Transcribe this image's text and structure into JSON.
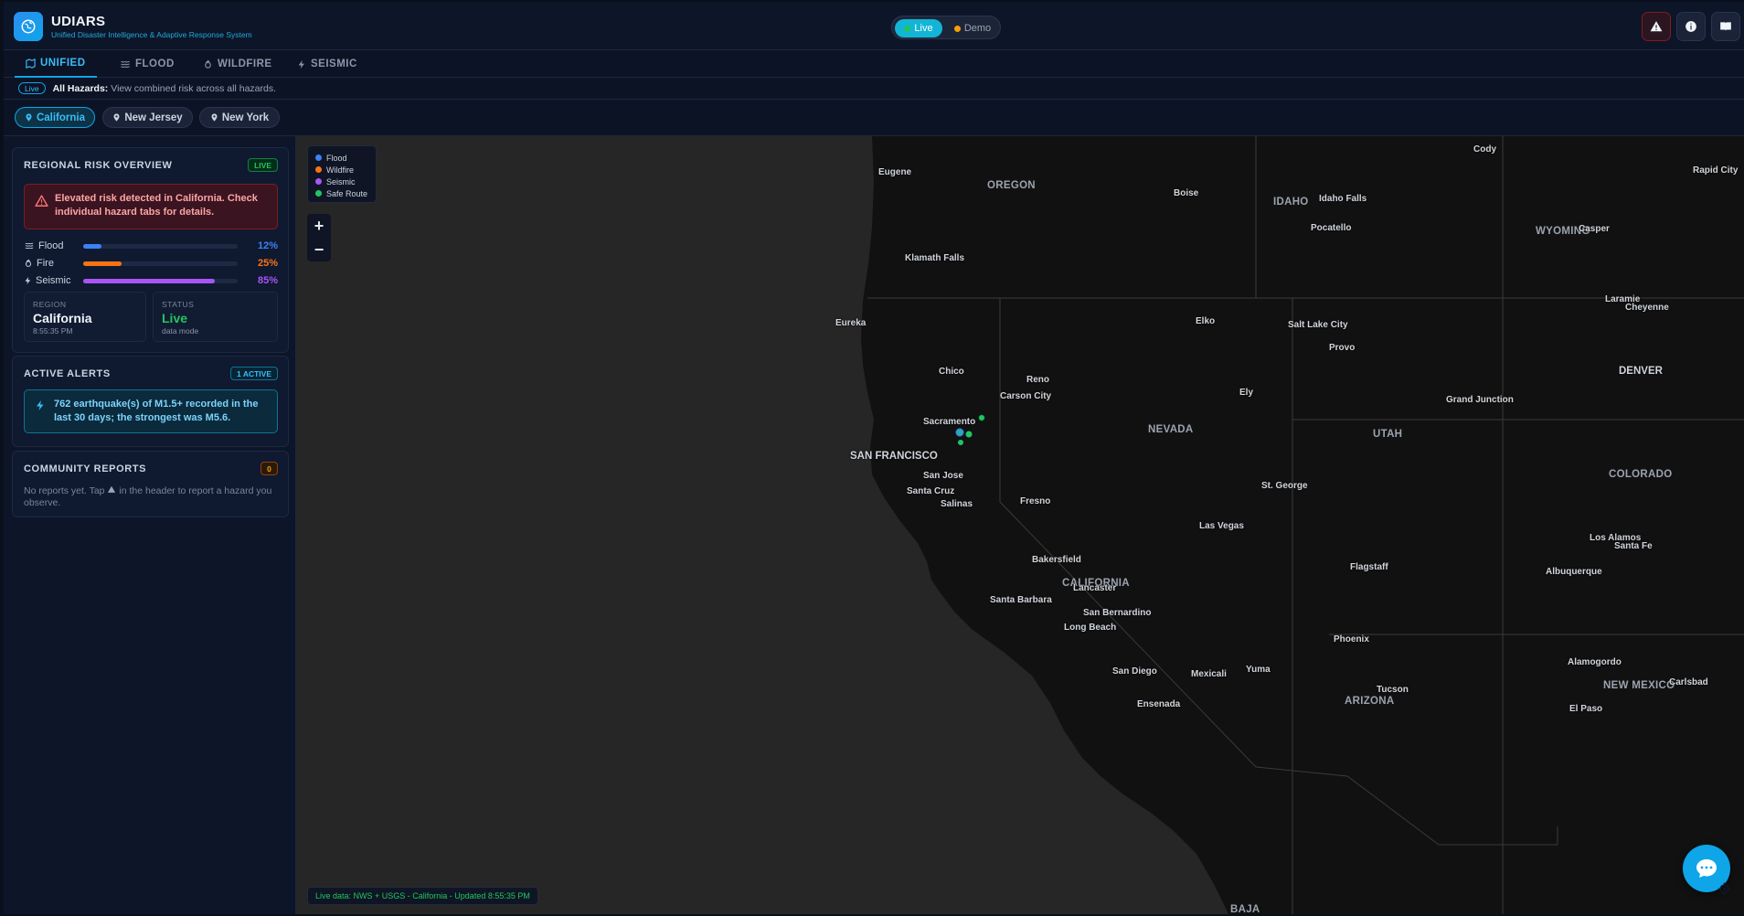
{
  "header": {
    "app_title": "UDIARS",
    "app_subtitle": "Unified Disaster Intelligence & Adaptive Response System",
    "modes": {
      "live": "Live",
      "demo": "Demo"
    }
  },
  "tabs": [
    {
      "label": "UNIFIED",
      "icon": "map-icon",
      "active": true
    },
    {
      "label": "FLOOD",
      "icon": "waves-icon",
      "active": false
    },
    {
      "label": "WILDFIRE",
      "icon": "flame-icon",
      "active": false
    },
    {
      "label": "SEISMIC",
      "icon": "bolt-icon",
      "active": false
    }
  ],
  "infobar": {
    "pill": "Live",
    "title": "All Hazards:",
    "text": "View combined risk across all hazards."
  },
  "regions": [
    {
      "label": "California",
      "active": true
    },
    {
      "label": "New Jersey",
      "active": false
    },
    {
      "label": "New York",
      "active": false
    }
  ],
  "risk_overview": {
    "title": "REGIONAL RISK OVERVIEW",
    "badge": "LIVE",
    "warning": "Elevated risk detected in California. Check individual hazard tabs for details.",
    "hazards": [
      {
        "label": "Flood",
        "icon": "waves-icon",
        "value": 12,
        "display": "12%",
        "color": "#3b82f6"
      },
      {
        "label": "Fire",
        "icon": "flame-icon",
        "value": 25,
        "display": "25%",
        "color": "#f97316"
      },
      {
        "label": "Seismic",
        "icon": "bolt-icon",
        "value": 85,
        "display": "85%",
        "color": "#a855f7"
      }
    ],
    "region_label": "REGION",
    "region_value": "California",
    "region_time": "8:55:35 PM",
    "status_label": "STATUS",
    "status_value": "Live",
    "status_sub": "data mode"
  },
  "active_alerts": {
    "title": "ACTIVE ALERTS",
    "badge": "1 ACTIVE",
    "alert_text": "762 earthquake(s) of M1.5+ recorded in the last 30 days; the strongest was M5.6."
  },
  "community": {
    "title": "COMMUNITY REPORTS",
    "count": "0",
    "empty_a": "No reports yet. Tap",
    "empty_b": "in the header to report a hazard you observe."
  },
  "legend": [
    {
      "label": "Flood",
      "color": "#3b82f6"
    },
    {
      "label": "Wildfire",
      "color": "#f97316"
    },
    {
      "label": "Seismic",
      "color": "#a855f7"
    },
    {
      "label": "Safe Route",
      "color": "#22c55e"
    }
  ],
  "map": {
    "zoom_in": "+",
    "zoom_out": "−",
    "footer": "Live data: NWS + USGS - California - Updated 8:55:35 PM",
    "cities": [
      "Eugene",
      "Cody",
      "Rapid City",
      "Boise",
      "Idaho Falls",
      "Pocatello",
      "Casper",
      "Klamath Falls",
      "Laramie",
      "Cheyenne",
      "Eureka",
      "Elko",
      "Salt Lake City",
      "Provo",
      "Chico",
      "Reno",
      "Carson City",
      "Ely",
      "Sacramento",
      "Grand Junction",
      "SAN FRANCISCO",
      "San Jose",
      "Santa Cruz",
      "Salinas",
      "Fresno",
      "St. George",
      "Las Vegas",
      "Los Alamos",
      "Santa Fe",
      "Bakersfield",
      "Flagstaff",
      "Albuquerque",
      "Lancaster",
      "Santa Barbara",
      "San Bernardino",
      "Long Beach",
      "Phoenix",
      "Alamogordo",
      "San Diego",
      "Mexicali",
      "Yuma",
      "Tucson",
      "Carlsbad",
      "Ensenada",
      "El Paso",
      "DENVER"
    ],
    "states": [
      "OREGON",
      "IDAHO",
      "WYOMING",
      "NEVADA",
      "UTAH",
      "COLORADO",
      "CALIFORNIA",
      "ARIZONA",
      "NEW MEXICO",
      "BAJA"
    ]
  }
}
